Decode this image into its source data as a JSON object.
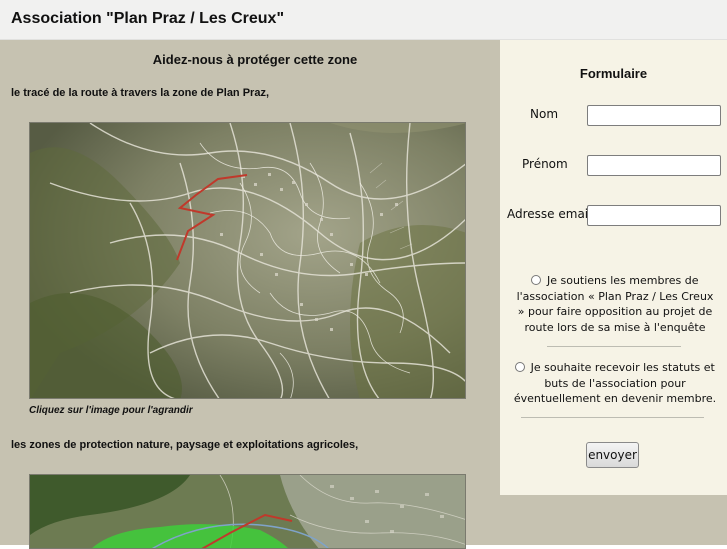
{
  "header": {
    "title": "Association \"Plan Praz / Les Creux\""
  },
  "content": {
    "heading": "Aidez-nous à protéger cette zone",
    "section1_label": "le tracé de la route à travers la zone de Plan Praz,",
    "map1_caption": "Cliquez sur l'image pour l'agrandir",
    "section2_label": "les zones de protection nature, paysage et exploitations agricoles,"
  },
  "form": {
    "title": "Formulaire",
    "nom_label": "Nom",
    "nom_value": "",
    "prenom_label": "Prénom",
    "prenom_value": "",
    "email_label": "Adresse email",
    "email_value": "",
    "option1_text": "Je soutiens les membres de l'association « Plan Praz / Les Creux » pour faire opposition au projet de route lors de sa mise à l'enquête",
    "option2_text": "Je souhaite recevoir les statuts et buts de l'association pour éventuellement en devenir membre.",
    "submit_label": "envoyer"
  },
  "colors": {
    "page_bg": "#c6c2b1",
    "form_bg": "#f6f3e6",
    "header_bg": "#f1f1f0",
    "route": "#c0392b",
    "protection_zone": "#3ecf3a"
  }
}
